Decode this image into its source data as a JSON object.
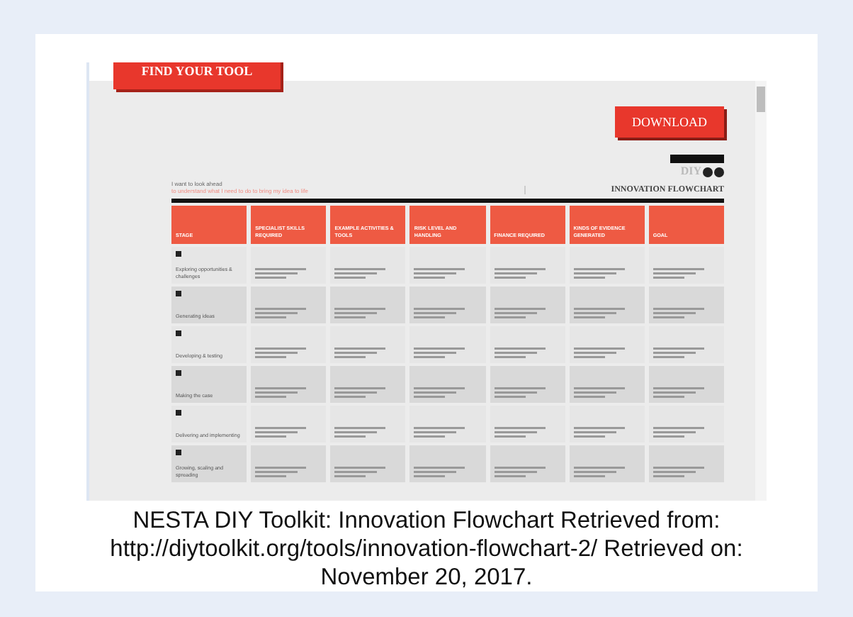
{
  "page": {
    "tab": "FIND YOUR TOOL",
    "download": "DOWNLOAD",
    "logo": "DIY",
    "intro": "I want to look ahead",
    "intro_goal": "to understand what I need to do to bring my idea to life",
    "title": "INNOVATION FLOWCHART"
  },
  "columns": [
    "STAGE",
    "SPECIALIST SKILLS REQUIRED",
    "EXAMPLE ACTIVITIES & TOOLS",
    "RISK LEVEL AND HANDLING",
    "FINANCE REQUIRED",
    "KINDS OF EVIDENCE GENERATED",
    "GOAL"
  ],
  "rows": [
    {
      "stage": "Exploring opportunities & challenges"
    },
    {
      "stage": "Generating ideas"
    },
    {
      "stage": "Developing & testing"
    },
    {
      "stage": "Making the case"
    },
    {
      "stage": "Delivering and implementing"
    },
    {
      "stage": "Growing, scaling and spreading"
    }
  ],
  "caption": "NESTA DIY Toolkit: Innovation Flowchart Retrieved from: http://diytoolkit.org/tools/innovation-flowchart-2/ Retrieved on: November 20, 2017."
}
